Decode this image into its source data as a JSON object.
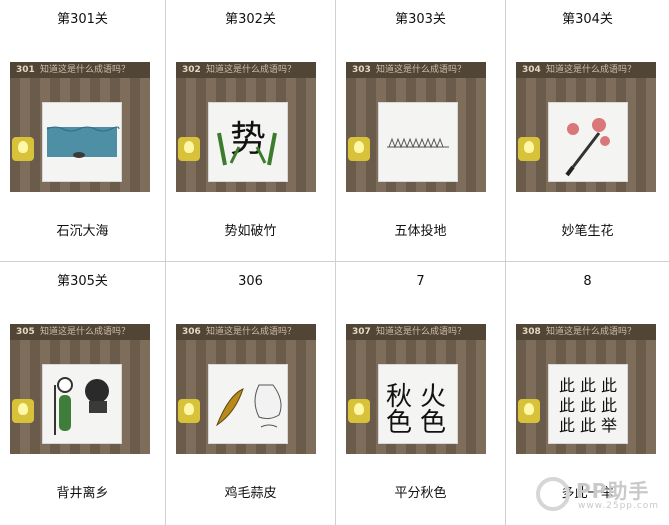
{
  "panel_question": "知道这是什么成语吗？",
  "levels": [
    {
      "title": "第301关",
      "badge": "301",
      "answer": "石沉大海",
      "icon": "sea-with-stone-icon"
    },
    {
      "title": "第302关",
      "badge": "302",
      "answer": "势如破竹",
      "icon": "bamboo-character-icon"
    },
    {
      "title": "第303关",
      "badge": "303",
      "answer": "五体投地",
      "icon": "five-bodies-on-ground-icon"
    },
    {
      "title": "第304关",
      "badge": "304",
      "answer": "妙笔生花",
      "icon": "brush-and-flowers-icon"
    },
    {
      "title": "第305关",
      "badge": "305",
      "answer": "背井离乡",
      "icon": "person-with-well-icon"
    },
    {
      "title": "306",
      "badge": "306",
      "answer": "鸡毛蒜皮",
      "icon": "feather-and-garlic-icon"
    },
    {
      "title": "7",
      "badge": "307",
      "answer": "平分秋色",
      "icon": "split-characters-icon",
      "card_text": [
        "秋",
        "火",
        "色",
        "色"
      ]
    },
    {
      "title": "8",
      "badge": "308",
      "answer": "多此一举",
      "icon": "many-ci-characters-icon",
      "card_text": [
        "此",
        "此",
        "此",
        "此",
        "此",
        "此",
        "此",
        "此",
        "举"
      ]
    }
  ],
  "watermark": {
    "brand": "PP助手",
    "url": "www.25pp.com"
  }
}
